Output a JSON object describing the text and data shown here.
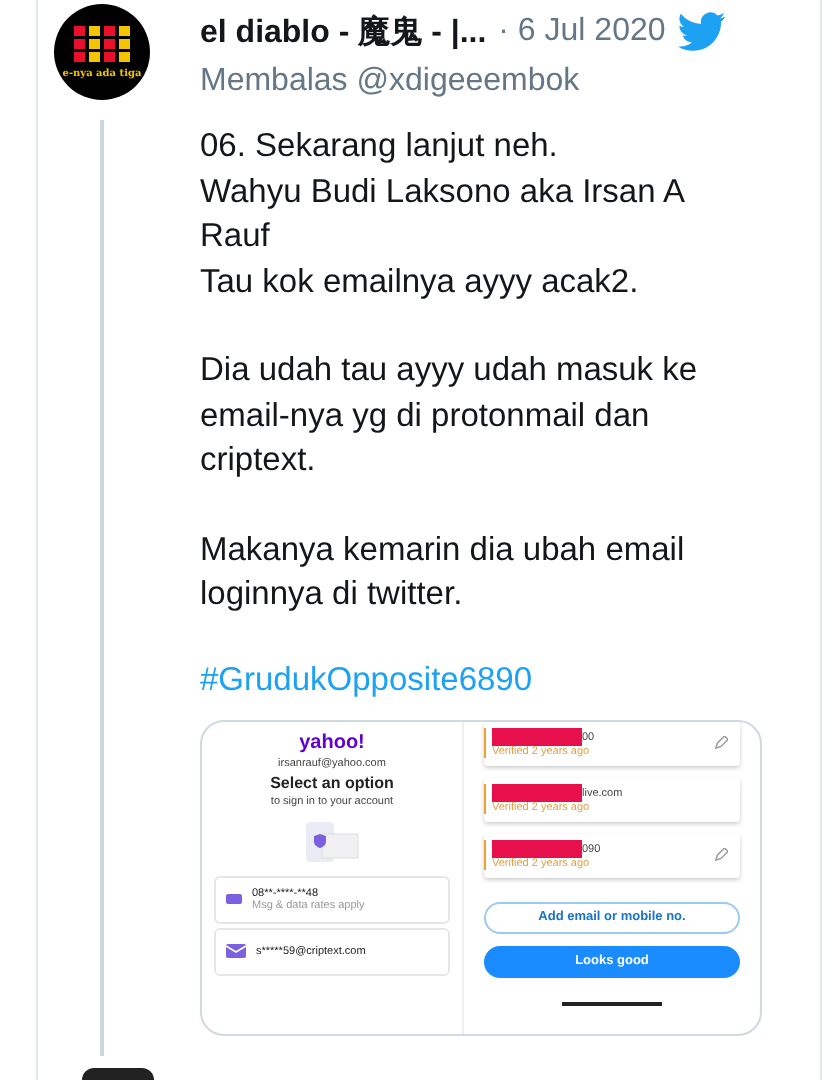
{
  "tweet": {
    "author": "el diablo - 魔鬼 - |...",
    "date": "· 6 Jul 2020",
    "avatar_caption": "e-nya ada tiga",
    "reply_to": "Membalas @xdigeeembok",
    "paragraphs": [
      "06. Sekarang lanjut neh.\nWahyu Budi Laksono aka Irsan A\nRauf\nTau kok emailnya ayyy acak2.",
      "Dia udah tau ayyy udah masuk ke\nemail-nya yg di protonmail dan\ncriptext.",
      "Makanya kemarin dia ubah email\nloginnya di twitter."
    ],
    "hashtag": "#GrudukOpposite6890"
  },
  "embedded": {
    "left": {
      "logo": "yahoo!",
      "account": "irsanrauf@yahoo.com",
      "heading": "Select an option",
      "subheading": "to sign in to your account",
      "options": [
        {
          "kind": "phone",
          "value": "08**-****-**48",
          "note": "Msg & data rates apply"
        },
        {
          "kind": "email",
          "value": "s*****59@criptext.com"
        }
      ]
    },
    "right": {
      "items": [
        {
          "value": "00",
          "status": "Verified 2 years ago",
          "editable": true
        },
        {
          "value": "live.com",
          "status": "Verified 2 years ago",
          "editable": false
        },
        {
          "value": "090",
          "status": "Verified 2 years ago",
          "editable": true
        }
      ],
      "add_button": "Add email or mobile no.",
      "confirm_button": "Looks good"
    }
  }
}
